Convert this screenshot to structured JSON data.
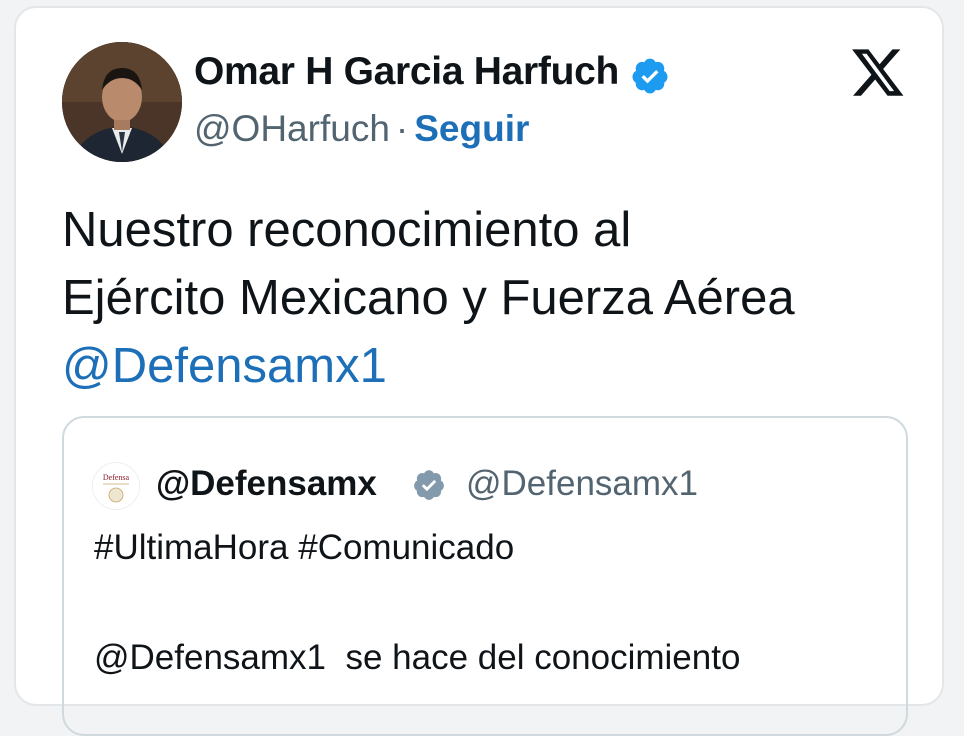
{
  "author": {
    "display_name": "Omar H Garcia Harfuch",
    "handle": "@OHarfuch",
    "separator": "·",
    "follow_label": "Seguir"
  },
  "tweet": {
    "text_line1": "Nuestro reconocimiento al",
    "text_line2": "Ejército Mexicano y Fuerza Aérea",
    "mention": "@Defensamx1"
  },
  "quoted": {
    "display_name": "@Defensamx",
    "handle": "@Defensamx1",
    "avatar_label": "Defensa",
    "line1": "#UltimaHora #Comunicado",
    "line2_mention": "@Defensamx1",
    "line2_rest": "  se hace del conocimiento"
  },
  "colors": {
    "link": "#1d6fb8",
    "verified": "#1d9bf0",
    "quoted_verified": "#829aab",
    "muted_text": "#536471"
  },
  "icons": [
    "verified-badge-icon",
    "x-logo-icon",
    "quoted-verified-badge-icon"
  ]
}
